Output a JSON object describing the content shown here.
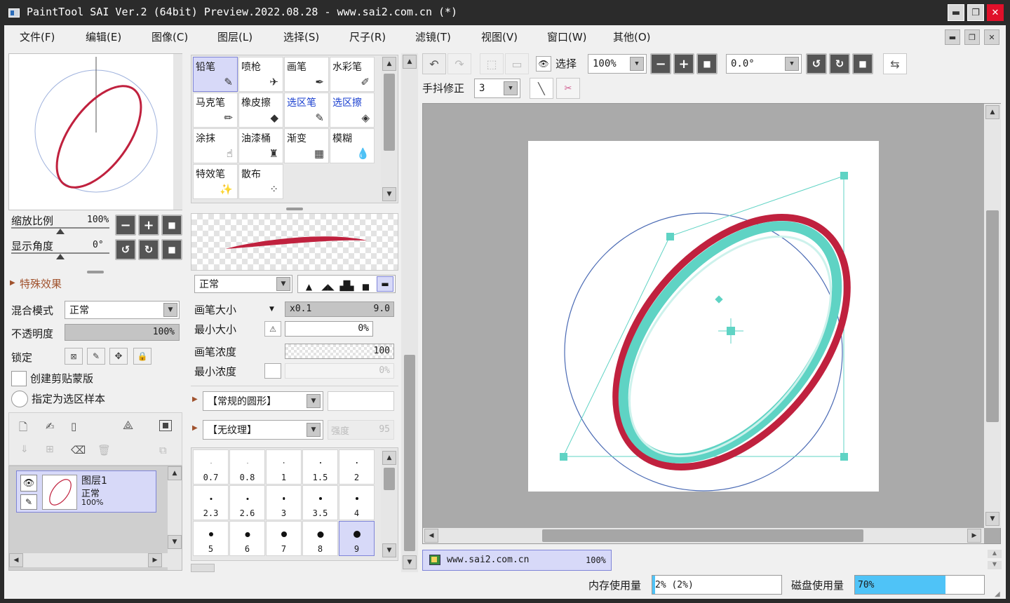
{
  "window": {
    "title": "PaintTool SAI Ver.2 (64bit) Preview.2022.08.28 - www.sai2.com.cn (*)",
    "minimize": "▬",
    "maximize": "❐",
    "close": "✕"
  },
  "menu": [
    "文件(F)",
    "编辑(E)",
    "图像(C)",
    "图层(L)",
    "选择(S)",
    "尺子(R)",
    "滤镜(T)",
    "视图(V)",
    "窗口(W)",
    "其他(O)"
  ],
  "navigator": {
    "zoom_label": "缩放比例",
    "zoom_value": "100%",
    "angle_label": "显示角度",
    "angle_value": "0°"
  },
  "layer_panel": {
    "special_effects": "特殊效果",
    "blend_label": "混合模式",
    "blend_value": "正常",
    "opacity_label": "不透明度",
    "opacity_value": "100%",
    "lock_label": "锁定",
    "clip_label": "创建剪贴蒙版",
    "sample_label": "指定为选区样本",
    "layer": {
      "name": "图层1",
      "mode": "正常",
      "opacity": "100%"
    }
  },
  "tools": [
    {
      "name": "铅笔",
      "icon": "✎",
      "selected": true,
      "blue": false
    },
    {
      "name": "喷枪",
      "icon": "✈",
      "selected": false,
      "blue": false
    },
    {
      "name": "画笔",
      "icon": "✒",
      "selected": false,
      "blue": false
    },
    {
      "name": "水彩笔",
      "icon": "✐",
      "selected": false,
      "blue": false
    },
    {
      "name": "马克笔",
      "icon": "✏",
      "selected": false,
      "blue": false
    },
    {
      "name": "橡皮擦",
      "icon": "◆",
      "selected": false,
      "blue": false
    },
    {
      "name": "选区笔",
      "icon": "✎",
      "selected": false,
      "blue": true
    },
    {
      "name": "选区擦",
      "icon": "◈",
      "selected": false,
      "blue": true
    },
    {
      "name": "涂抹",
      "icon": "☝",
      "selected": false,
      "blue": false
    },
    {
      "name": "油漆桶",
      "icon": "♜",
      "selected": false,
      "blue": false
    },
    {
      "name": "渐变",
      "icon": "▦",
      "selected": false,
      "blue": false
    },
    {
      "name": "模糊",
      "icon": "💧",
      "selected": false,
      "blue": false
    },
    {
      "name": "特效笔",
      "icon": "✨",
      "selected": false,
      "blue": false
    },
    {
      "name": "散布",
      "icon": "⁘",
      "selected": false,
      "blue": false
    }
  ],
  "brush": {
    "mode_value": "正常",
    "size_label": "画笔大小",
    "size_multiplier": "x0.1",
    "size_value": "9.0",
    "min_size_label": "最小大小",
    "min_size_value": "0%",
    "density_label": "画笔浓度",
    "density_value": "100",
    "min_density_label": "最小浓度",
    "min_density_value": "0%",
    "shape_value": "【常规的圆形】",
    "texture_value": "【无纹理】",
    "strength_label": "强度",
    "strength_value": "95"
  },
  "brush_sizes": [
    {
      "v": "0.7",
      "d": 1
    },
    {
      "v": "0.8",
      "d": 1
    },
    {
      "v": "1",
      "d": 1.5
    },
    {
      "v": "1.5",
      "d": 2
    },
    {
      "v": "2",
      "d": 2.5
    },
    {
      "v": "2.3",
      "d": 3
    },
    {
      "v": "2.6",
      "d": 3
    },
    {
      "v": "3",
      "d": 3.5
    },
    {
      "v": "3.5",
      "d": 4
    },
    {
      "v": "4",
      "d": 4
    },
    {
      "v": "5",
      "d": 6
    },
    {
      "v": "6",
      "d": 7
    },
    {
      "v": "7",
      "d": 8
    },
    {
      "v": "8",
      "d": 9
    },
    {
      "v": "9",
      "d": 10
    }
  ],
  "selected_brush_size_index": 14,
  "canvas_toolbar": {
    "select_label": "选择",
    "zoom_value": "100%",
    "angle_value": "0.0°",
    "stabilizer_label": "手抖修正",
    "stabilizer_value": "3"
  },
  "document_tab": {
    "name": "www.sai2.com.cn",
    "zoom": "100%"
  },
  "status": {
    "memory_label": "内存使用量",
    "memory_value": "2% (2%)",
    "memory_fraction": 0.02,
    "disk_label": "磁盘使用量",
    "disk_value": "70%",
    "disk_fraction": 0.7
  },
  "colors": {
    "stroke_red": "#c0213e",
    "stroke_teal": "#5fd3c4",
    "selection": "#7f85d8",
    "disk_bar": "#4fc3f7"
  }
}
